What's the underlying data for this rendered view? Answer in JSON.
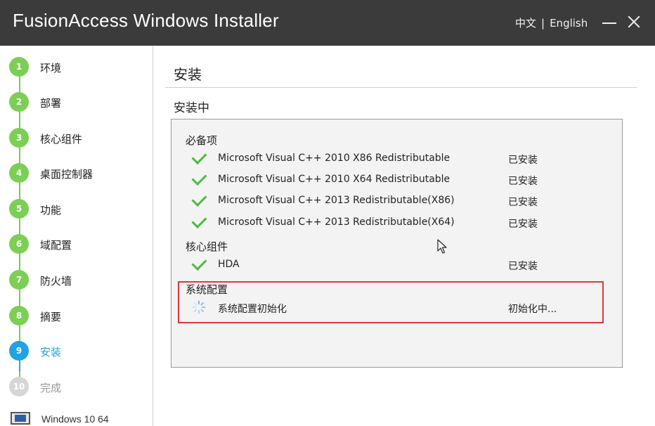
{
  "window": {
    "title": "FusionAccess Windows Installer",
    "lang_zh": "中文",
    "lang_separator": "|",
    "lang_en": "English"
  },
  "sidebar": {
    "steps": [
      {
        "number": "1",
        "label": "环境",
        "state": "done"
      },
      {
        "number": "2",
        "label": "部署",
        "state": "done"
      },
      {
        "number": "3",
        "label": "核心组件",
        "state": "done"
      },
      {
        "number": "4",
        "label": "桌面控制器",
        "state": "done"
      },
      {
        "number": "5",
        "label": "功能",
        "state": "done"
      },
      {
        "number": "6",
        "label": "域配置",
        "state": "done"
      },
      {
        "number": "7",
        "label": "防火墙",
        "state": "done"
      },
      {
        "number": "8",
        "label": "摘要",
        "state": "done"
      },
      {
        "number": "9",
        "label": "安装",
        "state": "active"
      },
      {
        "number": "10",
        "label": "完成",
        "state": "pending"
      }
    ],
    "os_label": "Windows 10 64"
  },
  "main": {
    "page_title": "安装",
    "section_title": "安装中",
    "groups": [
      {
        "title": "必备项",
        "items": [
          {
            "name": "Microsoft Visual C++ 2010 X86 Redistributable",
            "status": "已安装",
            "icon": "check-icon"
          },
          {
            "name": "Microsoft Visual C++ 2010 X64 Redistributable",
            "status": "已安装",
            "icon": "check-icon"
          },
          {
            "name": "Microsoft Visual C++ 2013 Redistributable(X86)",
            "status": "已安装",
            "icon": "check-icon"
          },
          {
            "name": "Microsoft Visual C++ 2013 Redistributable(X64)",
            "status": "已安装",
            "icon": "check-icon"
          }
        ]
      },
      {
        "title": "核心组件",
        "items": [
          {
            "name": "HDA",
            "status": "已安装",
            "icon": "check-icon"
          }
        ]
      },
      {
        "title": "系统配置",
        "items": [
          {
            "name": "系统配置初始化",
            "status": "初始化中...",
            "icon": "loading-spinner-icon"
          }
        ]
      }
    ]
  },
  "colors": {
    "titlebar": "#3b3b3b",
    "step_done": "#7ccf55",
    "step_active": "#1fa3e3",
    "step_pending": "#d6d6d6",
    "check": "#4cbb3f",
    "highlight": "#e0393b"
  }
}
